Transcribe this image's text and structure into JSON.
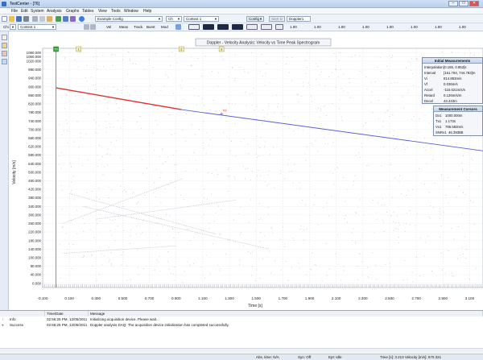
{
  "window": {
    "title": "TestCenter - [76]",
    "controls": [
      "–",
      "□",
      "✕"
    ]
  },
  "menu": [
    "File",
    "Edit",
    "System",
    "Analysis",
    "Graphs",
    "Tables",
    "View",
    "Tools",
    "Window",
    "Help"
  ],
  "toolbar": {
    "config_combo": "Example Config",
    "ch_combo": "Ch",
    "context_combo": "Context 1",
    "config_btn": "Config",
    "start_btn": "Start D",
    "doppler_combo": "Doppler1"
  },
  "toolbar2": {
    "ch_label": "Chi",
    "context_combo": "Context 1",
    "buttons": [
      "Vel",
      "Meas",
      "Track",
      "Burst",
      "Mod"
    ],
    "right_buttons": [
      "1.00",
      "1.00",
      "1.00",
      "1.00",
      "1.00",
      "1.00",
      "1.00",
      "1.00"
    ]
  },
  "plot": {
    "title": "Doppler - Velocity Analysis: Velocity vs Time Peak Spectrogram",
    "ylabel": "Velocity [m/s]",
    "xlabel": "Time [s]",
    "markers": [
      "T0",
      "1",
      "2",
      "3"
    ]
  },
  "chart_data": {
    "type": "line",
    "title": "Doppler - Velocity Analysis: Velocity vs Time Peak Spectrogram",
    "xlabel": "Time [s]",
    "ylabel": "Velocity [m/s]",
    "xlim": [
      -0.1,
      3.2
    ],
    "ylim": [
      -20,
      1100
    ],
    "x_ticks": [
      "-0.100",
      "0.100",
      "0.300",
      "0.500",
      "0.700",
      "0.900",
      "1.100",
      "1.300",
      "1.500",
      "1.700",
      "1.900",
      "2.100",
      "2.300",
      "2.500",
      "2.700",
      "2.900",
      "3.100"
    ],
    "y_ticks": [
      "0.000",
      "20.000",
      "60.000",
      "100.000",
      "140.000",
      "180.000",
      "220.000",
      "260.000",
      "300.000",
      "340.000",
      "380.000",
      "420.000",
      "460.000",
      "500.000",
      "540.000",
      "580.000",
      "620.000",
      "660.000",
      "700.000",
      "740.000",
      "780.000",
      "820.000",
      "860.000",
      "900.000",
      "940.000",
      "980.000",
      "1020.000",
      "1060.000",
      "1080.000"
    ],
    "y_tick_values": [
      0,
      40,
      80,
      120,
      160,
      200,
      240,
      280,
      320,
      360,
      400,
      440,
      480,
      520,
      560,
      600,
      640,
      680,
      720,
      760,
      800,
      840,
      880,
      920,
      960,
      1000,
      1040,
      1060,
      1080
    ],
    "y_tick_labels_visible": [
      "0.000",
      "40.000",
      "80.000",
      "100.000",
      "140.000",
      "180.000",
      "220.000",
      "260.000",
      "300.000",
      "340.000",
      "380.000",
      "420.000",
      "460.000",
      "500.000",
      "540.000",
      "580.000",
      "620.000",
      "660.000",
      "700.000",
      "740.000",
      "780.000",
      "820.000",
      "860.000",
      "900.000",
      "940.000",
      "980.000",
      "1020.000",
      "1060.000",
      "1080.000"
    ],
    "series": [
      {
        "name": "",
        "color": "#e03030",
        "points": [
          [
            0.0,
            915
          ],
          [
            0.94,
            813
          ]
        ]
      },
      {
        "name": "",
        "color": "#5b5fd0",
        "points": [
          [
            0.94,
            813
          ],
          [
            3.2,
            620
          ]
        ]
      }
    ],
    "markers": [
      {
        "label": "T0",
        "x": 0.0,
        "color": "#2fa52f"
      },
      {
        "label": "1",
        "x": 0.17,
        "color": "#d6c35a"
      },
      {
        "label": "2",
        "x": 0.94,
        "color": "#d6c35a"
      },
      {
        "label": "3",
        "x": 1.24,
        "color": "#d6c35a"
      }
    ],
    "annotation": {
      "label": "#3",
      "x": 1.24,
      "y": 793
    }
  },
  "panels": {
    "initial": {
      "title": "Initial Measurements",
      "rows": [
        {
          "k": "Interpolation",
          "v": "[0.165, 0.852]s"
        },
        {
          "k": "Interval",
          "v": "[161.784, 744.783]m"
        },
        {
          "k": "Vi",
          "v": "814.853m/s"
        },
        {
          "k": "Vf",
          "v": "0.036m/s"
        },
        {
          "k": "Accel",
          "v": "-115.021m/s/s"
        },
        {
          "k": "Retard",
          "v": "0.126m/s/m"
        },
        {
          "k": "Decel",
          "v": "43.443m"
        }
      ]
    },
    "cursors": {
      "title": "Measurement Cursors",
      "rows": [
        {
          "k": "Dx1",
          "v": "1000.000m"
        },
        {
          "k": "Tx1",
          "v": "1.173s"
        },
        {
          "k": "Vx1",
          "v": "795.583m/s"
        },
        {
          "k": "SNRx1",
          "v": "46.3938B"
        }
      ]
    }
  },
  "log": {
    "headers": [
      "",
      "Time/Date",
      "Message"
    ],
    "rows": [
      {
        "level": "Info",
        "time": "02:56:25 PM, 12/05/2011",
        "message": "Initializing acquisition device. Please wait..."
      },
      {
        "level": "Success",
        "time": "02:56:25 PM, 12/05/2011",
        "message": "Doppler analysis DAQ: The acquisition device initialization has completed successfully."
      }
    ]
  },
  "status": {
    "abs_time": "Abs. time: N/A",
    "sync": "Syn: Off",
    "ept": "Ept: Idle",
    "readout": "Time [s]: 3.213   Velocity [m/s]: 570.321"
  },
  "colors": {
    "accent_red": "#e03030",
    "accent_blue": "#5b5fd0",
    "t0_green": "#2fa52f",
    "marker_yellow": "#d6c35a"
  }
}
